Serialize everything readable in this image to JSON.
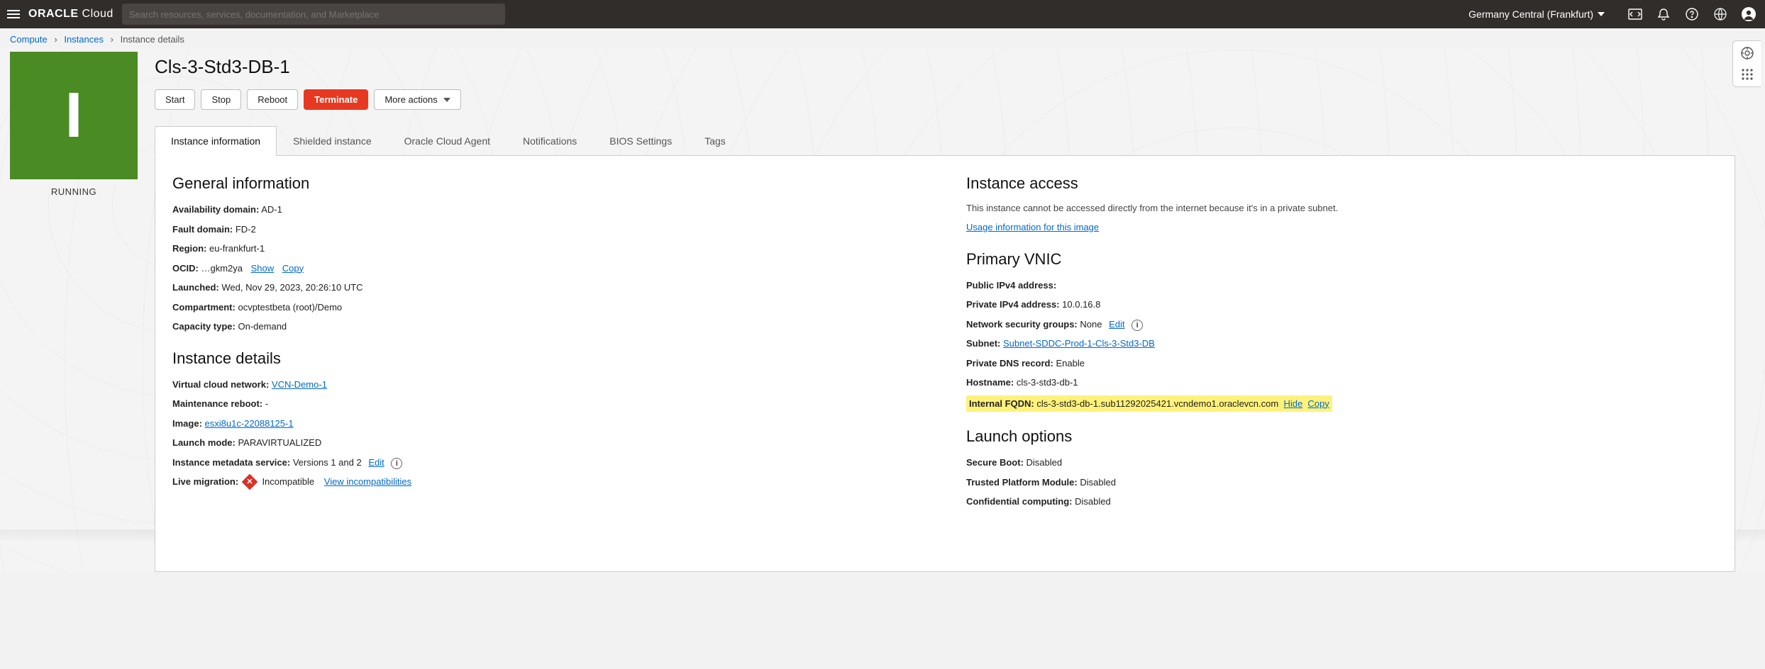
{
  "header": {
    "brand_bold": "ORACLE",
    "brand_light": "Cloud",
    "search_placeholder": "Search resources, services, documentation, and Marketplace",
    "region": "Germany Central (Frankfurt)"
  },
  "breadcrumb": {
    "a": "Compute",
    "b": "Instances",
    "c": "Instance details"
  },
  "instance": {
    "letter": "I",
    "status": "RUNNING",
    "title": "Cls-3-Std3-DB-1"
  },
  "actions": {
    "start": "Start",
    "stop": "Stop",
    "reboot": "Reboot",
    "terminate": "Terminate",
    "more": "More actions"
  },
  "tabs": {
    "info": "Instance information",
    "shield": "Shielded instance",
    "agent": "Oracle Cloud Agent",
    "notif": "Notifications",
    "bios": "BIOS Settings",
    "tags": "Tags"
  },
  "general": {
    "heading": "General information",
    "ad_k": "Availability domain:",
    "ad_v": "AD-1",
    "fd_k": "Fault domain:",
    "fd_v": "FD-2",
    "region_k": "Region:",
    "region_v": "eu-frankfurt-1",
    "ocid_k": "OCID:",
    "ocid_v": "…gkm2ya",
    "ocid_show": "Show",
    "ocid_copy": "Copy",
    "launched_k": "Launched:",
    "launched_v": "Wed, Nov 29, 2023, 20:26:10 UTC",
    "comp_k": "Compartment:",
    "comp_v": "ocvptestbeta (root)/Demo",
    "cap_k": "Capacity type:",
    "cap_v": "On-demand"
  },
  "details": {
    "heading": "Instance details",
    "vcn_k": "Virtual cloud network:",
    "vcn_link": "VCN-Demo-1",
    "maint_k": "Maintenance reboot:",
    "maint_v": "-",
    "image_k": "Image:",
    "image_link": "esxi8u1c-22088125-1",
    "launch_k": "Launch mode:",
    "launch_v": "PARAVIRTUALIZED",
    "meta_k": "Instance metadata service:",
    "meta_v": "Versions 1 and 2",
    "meta_edit": "Edit",
    "live_k": "Live migration:",
    "live_badge": "Incompatible",
    "live_view": "View incompatibilities"
  },
  "access": {
    "heading": "Instance access",
    "note": "This instance cannot be accessed directly from the internet because it's in a private subnet.",
    "usage_link": "Usage information for this image"
  },
  "vnic": {
    "heading": "Primary VNIC",
    "pub_k": "Public IPv4 address:",
    "priv_k": "Private IPv4 address:",
    "priv_v": "10.0.16.8",
    "nsg_k": "Network security groups:",
    "nsg_v": "None",
    "nsg_edit": "Edit",
    "subnet_k": "Subnet:",
    "subnet_link": "Subnet-SDDC-Prod-1-Cls-3-Std3-DB",
    "dns_k": "Private DNS record:",
    "dns_v": "Enable",
    "host_k": "Hostname:",
    "host_v": "cls-3-std3-db-1",
    "fqdn_k": "Internal FQDN:",
    "fqdn_v": "cls-3-std3-db-1.sub11292025421.vcndemo1.oraclevcn.com",
    "fqdn_hide": "Hide",
    "fqdn_copy": "Copy"
  },
  "launchopt": {
    "heading": "Launch options",
    "sb_k": "Secure Boot:",
    "sb_v": "Disabled",
    "tpm_k": "Trusted Platform Module:",
    "tpm_v": "Disabled",
    "cc_k": "Confidential computing:",
    "cc_v": "Disabled"
  }
}
